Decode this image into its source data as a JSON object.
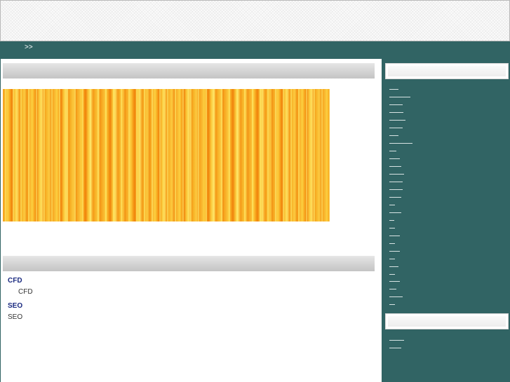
{
  "breadcrumb": ">>",
  "entries": [
    {
      "title": "CFD",
      "text": "CFD"
    },
    {
      "title": "SEO",
      "text": "SEO"
    }
  ],
  "colors": {
    "nav_bg": "#316464",
    "title_text": "#1a2a80",
    "banner_orange": "#f7a21c",
    "banner_yellow": "#fcd040"
  },
  "banner_icon": "orange-stripe-banner"
}
